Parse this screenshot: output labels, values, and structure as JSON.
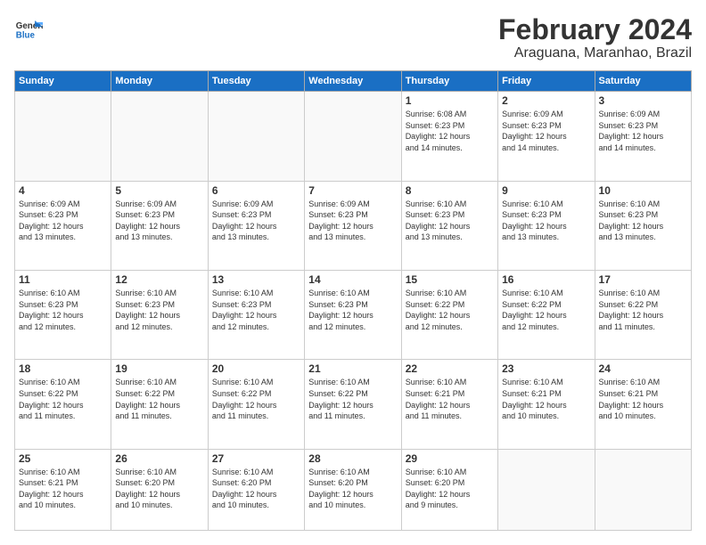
{
  "logo": {
    "line1": "General",
    "line2": "Blue"
  },
  "header": {
    "month": "February 2024",
    "location": "Araguana, Maranhao, Brazil"
  },
  "weekdays": [
    "Sunday",
    "Monday",
    "Tuesday",
    "Wednesday",
    "Thursday",
    "Friday",
    "Saturday"
  ],
  "weeks": [
    [
      {
        "day": "",
        "info": ""
      },
      {
        "day": "",
        "info": ""
      },
      {
        "day": "",
        "info": ""
      },
      {
        "day": "",
        "info": ""
      },
      {
        "day": "1",
        "info": "Sunrise: 6:08 AM\nSunset: 6:23 PM\nDaylight: 12 hours\nand 14 minutes."
      },
      {
        "day": "2",
        "info": "Sunrise: 6:09 AM\nSunset: 6:23 PM\nDaylight: 12 hours\nand 14 minutes."
      },
      {
        "day": "3",
        "info": "Sunrise: 6:09 AM\nSunset: 6:23 PM\nDaylight: 12 hours\nand 14 minutes."
      }
    ],
    [
      {
        "day": "4",
        "info": "Sunrise: 6:09 AM\nSunset: 6:23 PM\nDaylight: 12 hours\nand 13 minutes."
      },
      {
        "day": "5",
        "info": "Sunrise: 6:09 AM\nSunset: 6:23 PM\nDaylight: 12 hours\nand 13 minutes."
      },
      {
        "day": "6",
        "info": "Sunrise: 6:09 AM\nSunset: 6:23 PM\nDaylight: 12 hours\nand 13 minutes."
      },
      {
        "day": "7",
        "info": "Sunrise: 6:09 AM\nSunset: 6:23 PM\nDaylight: 12 hours\nand 13 minutes."
      },
      {
        "day": "8",
        "info": "Sunrise: 6:10 AM\nSunset: 6:23 PM\nDaylight: 12 hours\nand 13 minutes."
      },
      {
        "day": "9",
        "info": "Sunrise: 6:10 AM\nSunset: 6:23 PM\nDaylight: 12 hours\nand 13 minutes."
      },
      {
        "day": "10",
        "info": "Sunrise: 6:10 AM\nSunset: 6:23 PM\nDaylight: 12 hours\nand 13 minutes."
      }
    ],
    [
      {
        "day": "11",
        "info": "Sunrise: 6:10 AM\nSunset: 6:23 PM\nDaylight: 12 hours\nand 12 minutes."
      },
      {
        "day": "12",
        "info": "Sunrise: 6:10 AM\nSunset: 6:23 PM\nDaylight: 12 hours\nand 12 minutes."
      },
      {
        "day": "13",
        "info": "Sunrise: 6:10 AM\nSunset: 6:23 PM\nDaylight: 12 hours\nand 12 minutes."
      },
      {
        "day": "14",
        "info": "Sunrise: 6:10 AM\nSunset: 6:23 PM\nDaylight: 12 hours\nand 12 minutes."
      },
      {
        "day": "15",
        "info": "Sunrise: 6:10 AM\nSunset: 6:22 PM\nDaylight: 12 hours\nand 12 minutes."
      },
      {
        "day": "16",
        "info": "Sunrise: 6:10 AM\nSunset: 6:22 PM\nDaylight: 12 hours\nand 12 minutes."
      },
      {
        "day": "17",
        "info": "Sunrise: 6:10 AM\nSunset: 6:22 PM\nDaylight: 12 hours\nand 11 minutes."
      }
    ],
    [
      {
        "day": "18",
        "info": "Sunrise: 6:10 AM\nSunset: 6:22 PM\nDaylight: 12 hours\nand 11 minutes."
      },
      {
        "day": "19",
        "info": "Sunrise: 6:10 AM\nSunset: 6:22 PM\nDaylight: 12 hours\nand 11 minutes."
      },
      {
        "day": "20",
        "info": "Sunrise: 6:10 AM\nSunset: 6:22 PM\nDaylight: 12 hours\nand 11 minutes."
      },
      {
        "day": "21",
        "info": "Sunrise: 6:10 AM\nSunset: 6:22 PM\nDaylight: 12 hours\nand 11 minutes."
      },
      {
        "day": "22",
        "info": "Sunrise: 6:10 AM\nSunset: 6:21 PM\nDaylight: 12 hours\nand 11 minutes."
      },
      {
        "day": "23",
        "info": "Sunrise: 6:10 AM\nSunset: 6:21 PM\nDaylight: 12 hours\nand 10 minutes."
      },
      {
        "day": "24",
        "info": "Sunrise: 6:10 AM\nSunset: 6:21 PM\nDaylight: 12 hours\nand 10 minutes."
      }
    ],
    [
      {
        "day": "25",
        "info": "Sunrise: 6:10 AM\nSunset: 6:21 PM\nDaylight: 12 hours\nand 10 minutes."
      },
      {
        "day": "26",
        "info": "Sunrise: 6:10 AM\nSunset: 6:20 PM\nDaylight: 12 hours\nand 10 minutes."
      },
      {
        "day": "27",
        "info": "Sunrise: 6:10 AM\nSunset: 6:20 PM\nDaylight: 12 hours\nand 10 minutes."
      },
      {
        "day": "28",
        "info": "Sunrise: 6:10 AM\nSunset: 6:20 PM\nDaylight: 12 hours\nand 10 minutes."
      },
      {
        "day": "29",
        "info": "Sunrise: 6:10 AM\nSunset: 6:20 PM\nDaylight: 12 hours\nand 9 minutes."
      },
      {
        "day": "",
        "info": ""
      },
      {
        "day": "",
        "info": ""
      }
    ]
  ]
}
